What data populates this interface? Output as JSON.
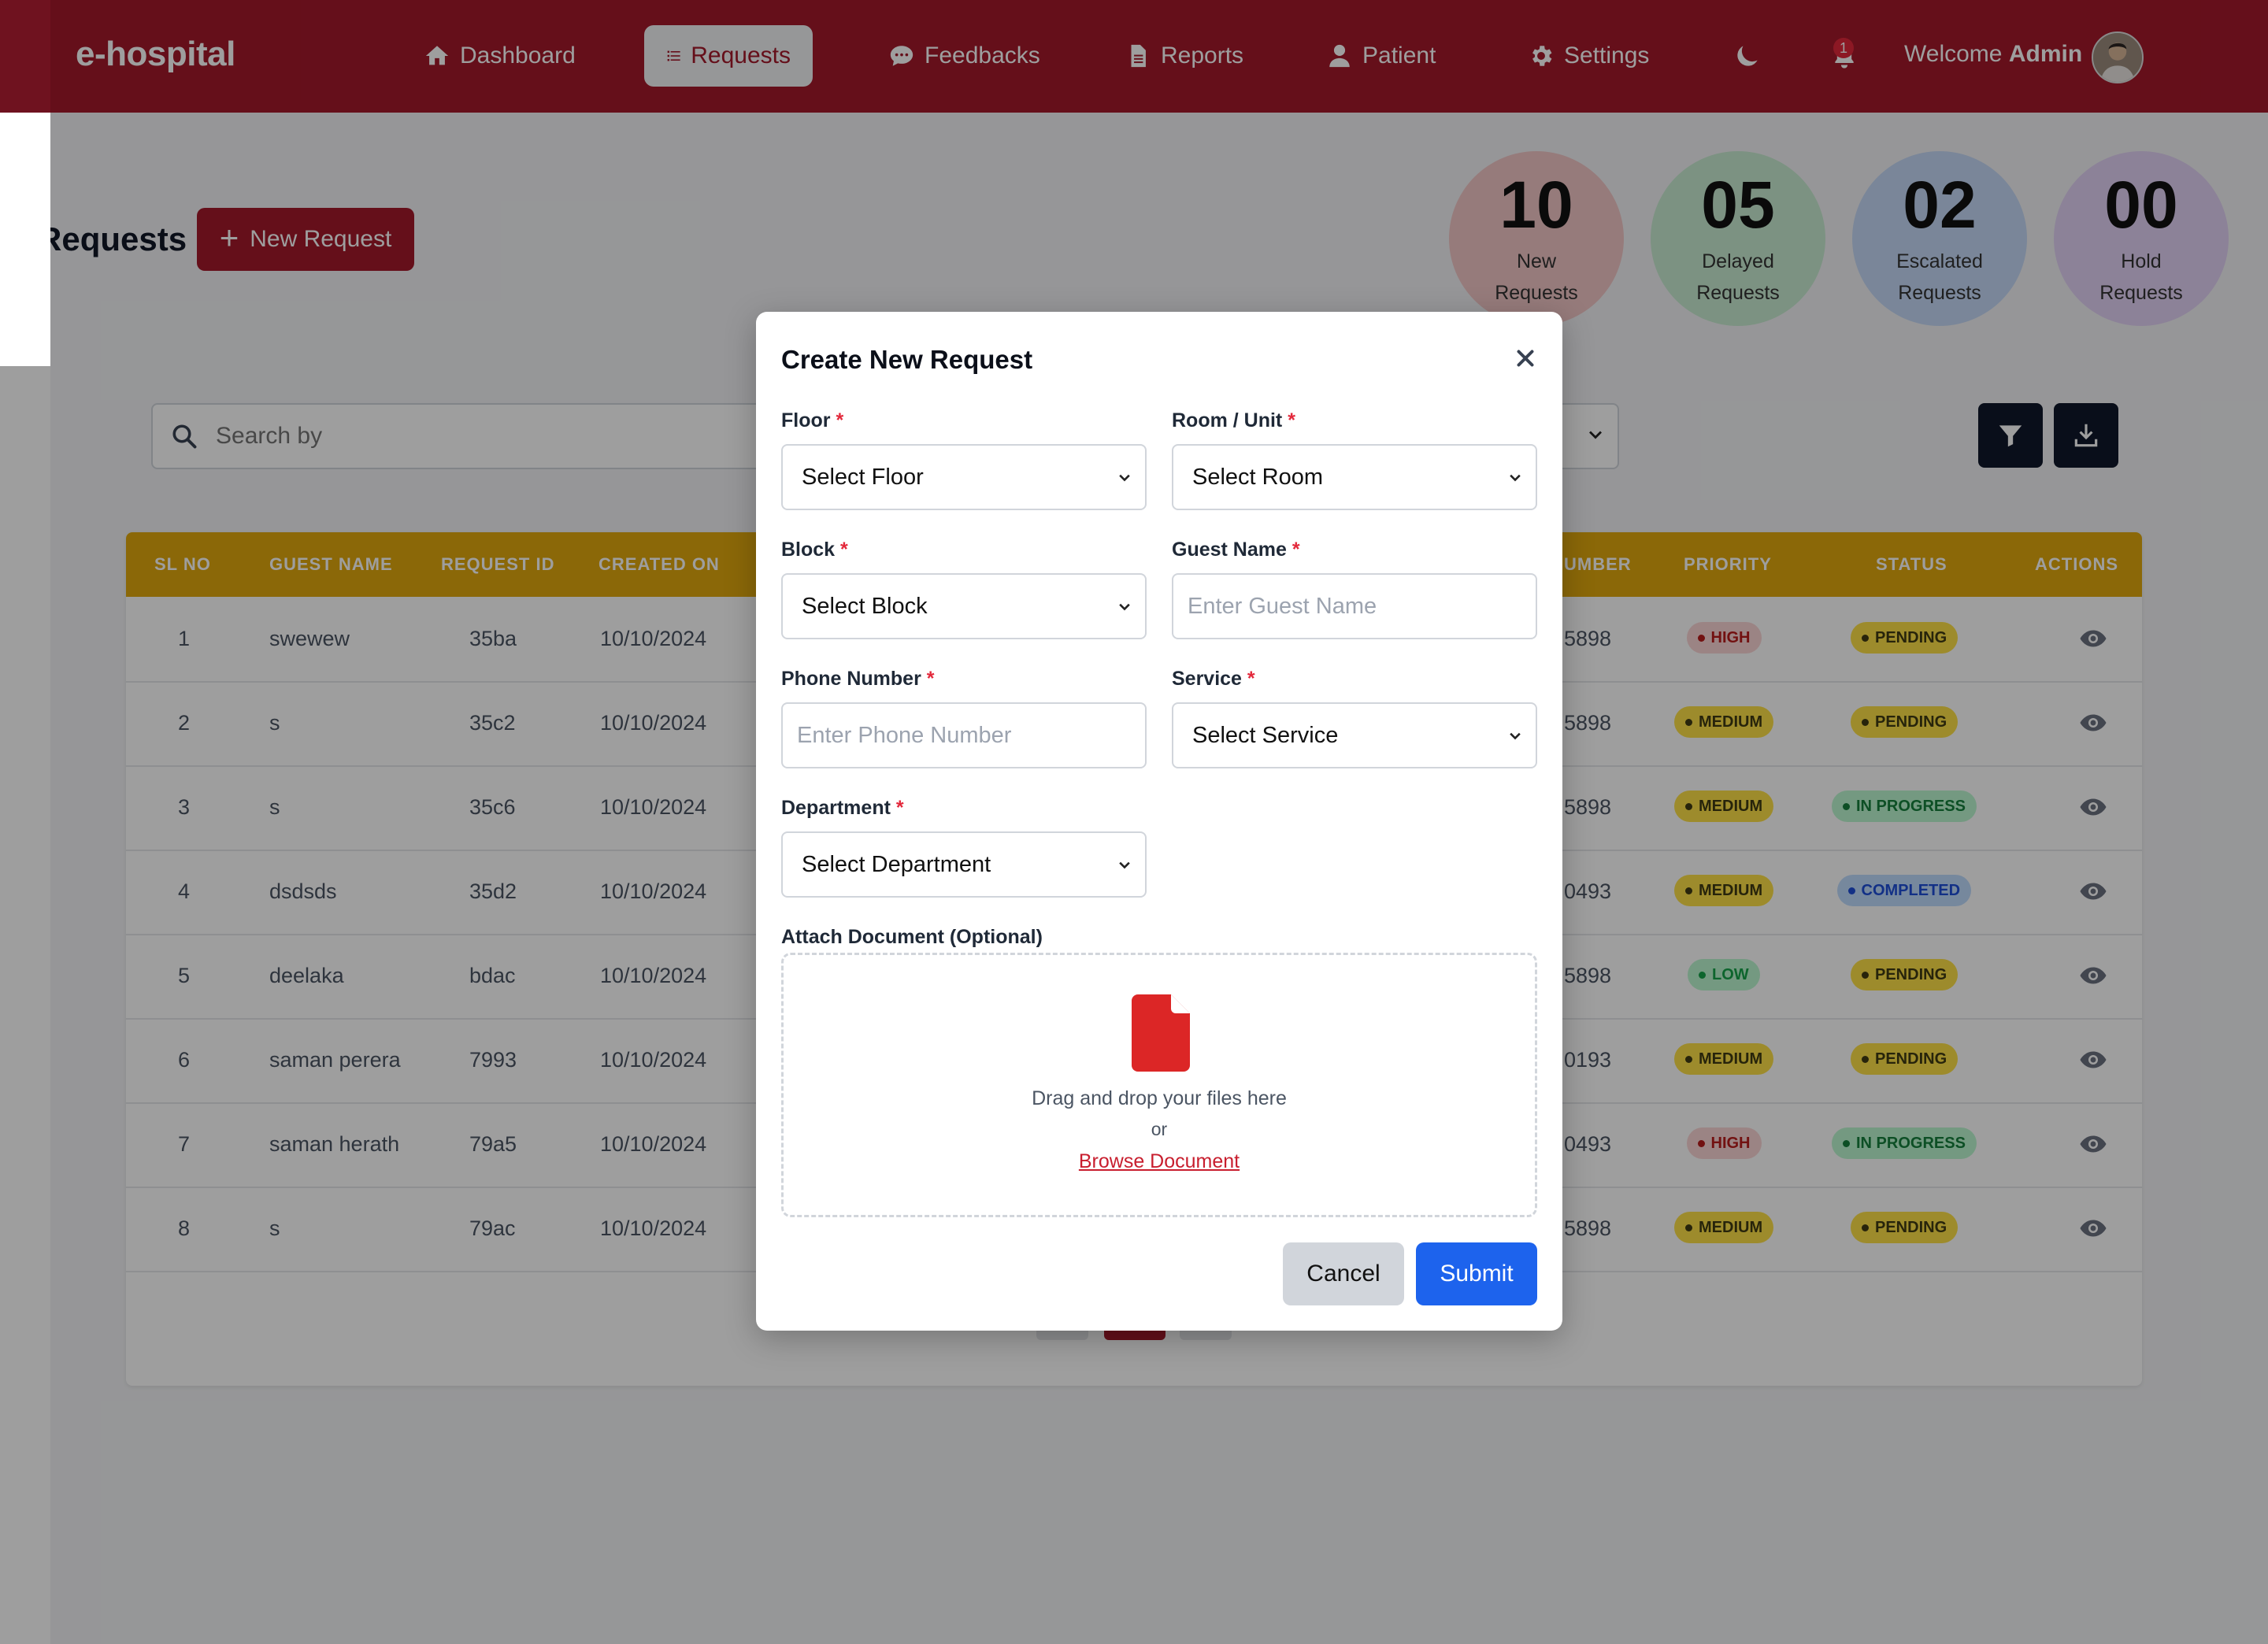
{
  "app": {
    "logo": "e-hospital"
  },
  "nav": {
    "items": [
      {
        "label": "Dashboard",
        "icon": "home-icon"
      },
      {
        "label": "Requests",
        "icon": "list-icon",
        "active": true
      },
      {
        "label": "Feedbacks",
        "icon": "chat-icon"
      },
      {
        "label": "Reports",
        "icon": "document-icon"
      },
      {
        "label": "Patient",
        "icon": "user-icon"
      },
      {
        "label": "Settings",
        "icon": "gear-icon"
      }
    ],
    "notification_count": "1",
    "welcome_prefix": "Welcome",
    "welcome_user": "Admin"
  },
  "page": {
    "title": "Requests",
    "new_request_label": "New Request"
  },
  "stats": [
    {
      "value": "10",
      "label": "New Requests",
      "color": "#f2c7c7"
    },
    {
      "value": "05",
      "label": "Delayed Requests",
      "color": "#c9ecd2"
    },
    {
      "value": "02",
      "label": "Escalated Requests",
      "color": "#c5d9f7"
    },
    {
      "value": "00",
      "label": "Hold Requests",
      "color": "#e3d2f5"
    }
  ],
  "filters": {
    "search_placeholder": "Search by"
  },
  "table": {
    "columns": [
      "SL NO",
      "GUEST NAME",
      "REQUEST ID",
      "CREATED ON",
      "UMBER",
      "PRIORITY",
      "STATUS",
      "ACTIONS"
    ],
    "rows": [
      {
        "sl": "1",
        "guest": "swewew",
        "id": "35ba",
        "created": "10/10/2024",
        "number": "5898",
        "priority": "HIGH",
        "status": "PENDING"
      },
      {
        "sl": "2",
        "guest": "s",
        "id": "35c2",
        "created": "10/10/2024",
        "number": "5898",
        "priority": "MEDIUM",
        "status": "PENDING"
      },
      {
        "sl": "3",
        "guest": "s",
        "id": "35c6",
        "created": "10/10/2024",
        "number": "5898",
        "priority": "MEDIUM",
        "status": "IN PROGRESS"
      },
      {
        "sl": "4",
        "guest": "dsdsds",
        "id": "35d2",
        "created": "10/10/2024",
        "number": "0493",
        "priority": "MEDIUM",
        "status": "COMPLETED"
      },
      {
        "sl": "5",
        "guest": "deelaka",
        "id": "bdac",
        "created": "10/10/2024",
        "number": "5898",
        "priority": "LOW",
        "status": "PENDING"
      },
      {
        "sl": "6",
        "guest": "saman perera",
        "id": "7993",
        "created": "10/10/2024",
        "number": "0193",
        "priority": "MEDIUM",
        "status": "PENDING"
      },
      {
        "sl": "7",
        "guest": "saman herath",
        "id": "79a5",
        "created": "10/10/2024",
        "number": "0493",
        "priority": "HIGH",
        "status": "IN PROGRESS"
      },
      {
        "sl": "8",
        "guest": "s",
        "id": "79ac",
        "created": "10/10/2024",
        "number": "5898",
        "priority": "MEDIUM",
        "status": "PENDING"
      }
    ],
    "current_page": "1"
  },
  "badge_colors": {
    "HIGH": {
      "bg": "#fbd5d5",
      "fg": "#b91c1c",
      "dot": "#b91c1c"
    },
    "MEDIUM": {
      "bg": "#fde047",
      "fg": "#3f3a12",
      "dot": "#3f3a12"
    },
    "LOW": {
      "bg": "#bbf7d0",
      "fg": "#16a34a",
      "dot": "#16a34a"
    },
    "PENDING": {
      "bg": "#fde047",
      "fg": "#3f3a12",
      "dot": "#3f3a12"
    },
    "IN PROGRESS": {
      "bg": "#bbf7d0",
      "fg": "#15803d",
      "dot": "#15803d"
    },
    "COMPLETED": {
      "bg": "#bfdbfe",
      "fg": "#1d4ed8",
      "dot": "#1d4ed8"
    }
  },
  "modal": {
    "title": "Create New Request",
    "floor": {
      "label": "Floor",
      "value": "Select Floor"
    },
    "room": {
      "label": "Room / Unit",
      "value": "Select Room"
    },
    "block": {
      "label": "Block",
      "value": "Select Block"
    },
    "guest_name": {
      "label": "Guest Name",
      "placeholder": "Enter Guest Name"
    },
    "phone": {
      "label": "Phone Number",
      "placeholder": "Enter Phone Number"
    },
    "service": {
      "label": "Service",
      "value": "Select Service"
    },
    "department": {
      "label": "Department",
      "value": "Select Department"
    },
    "attach": {
      "label": "Attach Document (Optional)",
      "drag_text": "Drag and drop your files here",
      "or_text": "or",
      "browse_label": "Browse Document"
    },
    "required_mark": "*",
    "cancel_label": "Cancel",
    "submit_label": "Submit"
  },
  "colors": {
    "brand": "#a3192b",
    "table_header": "#e0a80e",
    "submit": "#1d63ed"
  }
}
